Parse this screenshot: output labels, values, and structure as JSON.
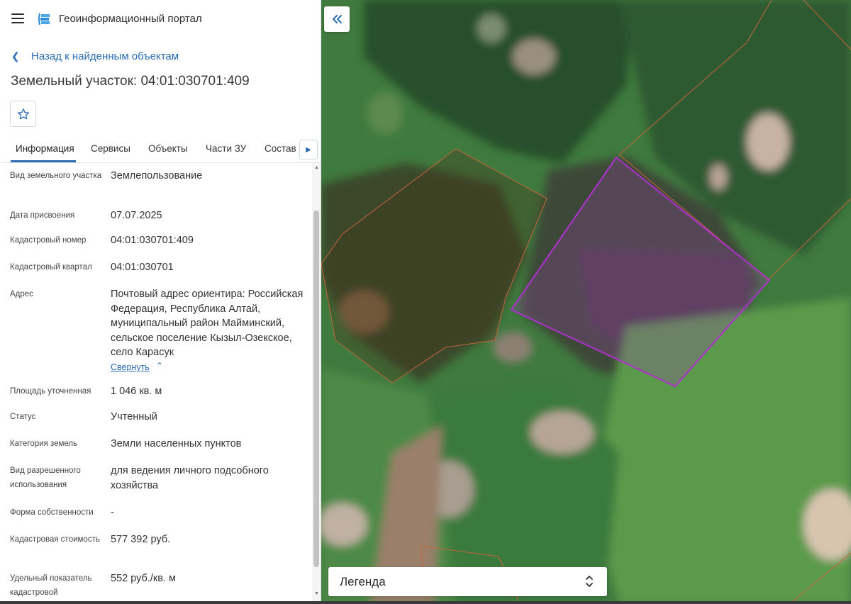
{
  "header": {
    "app_title": "Геоинформационный портал"
  },
  "navigation": {
    "back_label": "Назад к найденным объектам"
  },
  "object": {
    "title": "Земельный участок: 04:01:030701:409"
  },
  "tabs": [
    {
      "label": "Информация",
      "active": true
    },
    {
      "label": "Сервисы",
      "active": false
    },
    {
      "label": "Объекты",
      "active": false
    },
    {
      "label": "Части ЗУ",
      "active": false
    },
    {
      "label": "Состав",
      "active": false
    }
  ],
  "properties": [
    {
      "label": "Вид земельного участка",
      "value": "Землепользование"
    },
    {
      "label": "Дата присвоения",
      "value": "07.07.2025"
    },
    {
      "label": "Кадастровый номер",
      "value": "04:01:030701:409"
    },
    {
      "label": "Кадастровый квартал",
      "value": "04:01:030701"
    },
    {
      "label": "Адрес",
      "value": "Почтовый адрес ориентира: Российская Федерация, Республика Алтай, муниципальный район Майминский, сельское поселение Кызыл-Озекское, село Карасук"
    },
    {
      "label": "Площадь уточненная",
      "value": "1 046 кв. м"
    },
    {
      "label": "Статус",
      "value": "Учтенный"
    },
    {
      "label": "Категория земель",
      "value": "Земли населенных пунктов"
    },
    {
      "label": "Вид разрешенного использования",
      "value": "для ведения личного подсобного хозяйства"
    },
    {
      "label": "Форма собственности",
      "value": "-"
    },
    {
      "label": "Кадастровая стоимость",
      "value": "577 392 руб."
    },
    {
      "label": "Удельный показатель кадастровой",
      "value": "552 руб./кв. м"
    }
  ],
  "address_toggle": {
    "label": "Свернуть"
  },
  "map": {
    "legend_label": "Легенда",
    "colors": {
      "selected_parcel": "#b02fd0",
      "parcel_border": "#c8643c",
      "accent": "#2a6db5"
    }
  }
}
